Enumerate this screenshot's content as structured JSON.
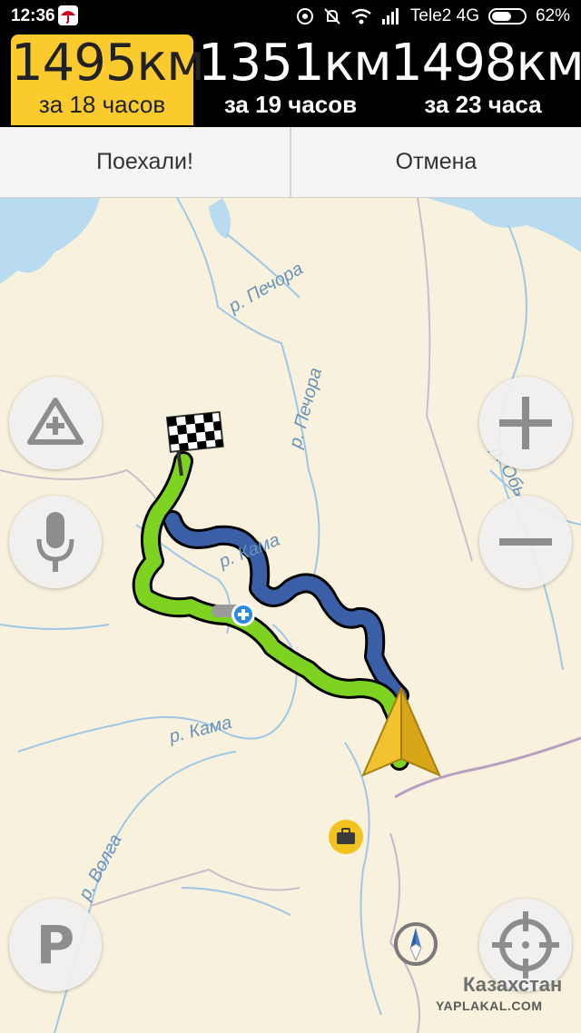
{
  "status_bar": {
    "time": "12:36",
    "carrier": "Tele2 4G",
    "battery": "62%",
    "battery_level": 0.62
  },
  "routes": [
    {
      "distance": "1495км",
      "duration": "за 18 часов",
      "selected": true
    },
    {
      "distance": "1351км",
      "duration": "за 19 часов",
      "selected": false
    },
    {
      "distance": "1498км",
      "duration": "за 23 часа",
      "selected": false
    }
  ],
  "actions": {
    "go_label": "Поехали!",
    "cancel_label": "Отмена"
  },
  "map": {
    "labels": {
      "pechora_1": "р. Печора",
      "pechora_2": "р. Печора",
      "ob": "р. Обь",
      "kama_1": "р. Кама",
      "kama_2": "р. Кама",
      "volga": "р. Волга",
      "kazakhstan": "Казахстан"
    },
    "parking_letter": "P",
    "colors": {
      "selected_route": "#7ed321",
      "alt_route": "#3a5fa6",
      "cursor": "#f2c230",
      "water": "#b9dbf0",
      "land": "#f7f1dd"
    },
    "icons": [
      "add-road-event-icon",
      "microphone-icon",
      "zoom-in-icon",
      "zoom-out-icon",
      "parking-icon",
      "compass-icon",
      "locate-me-icon",
      "finish-flag-icon",
      "via-point-icon",
      "navigation-cursor-icon",
      "poi-briefcase-icon"
    ]
  },
  "watermark": "YAPLAKAL.COM"
}
